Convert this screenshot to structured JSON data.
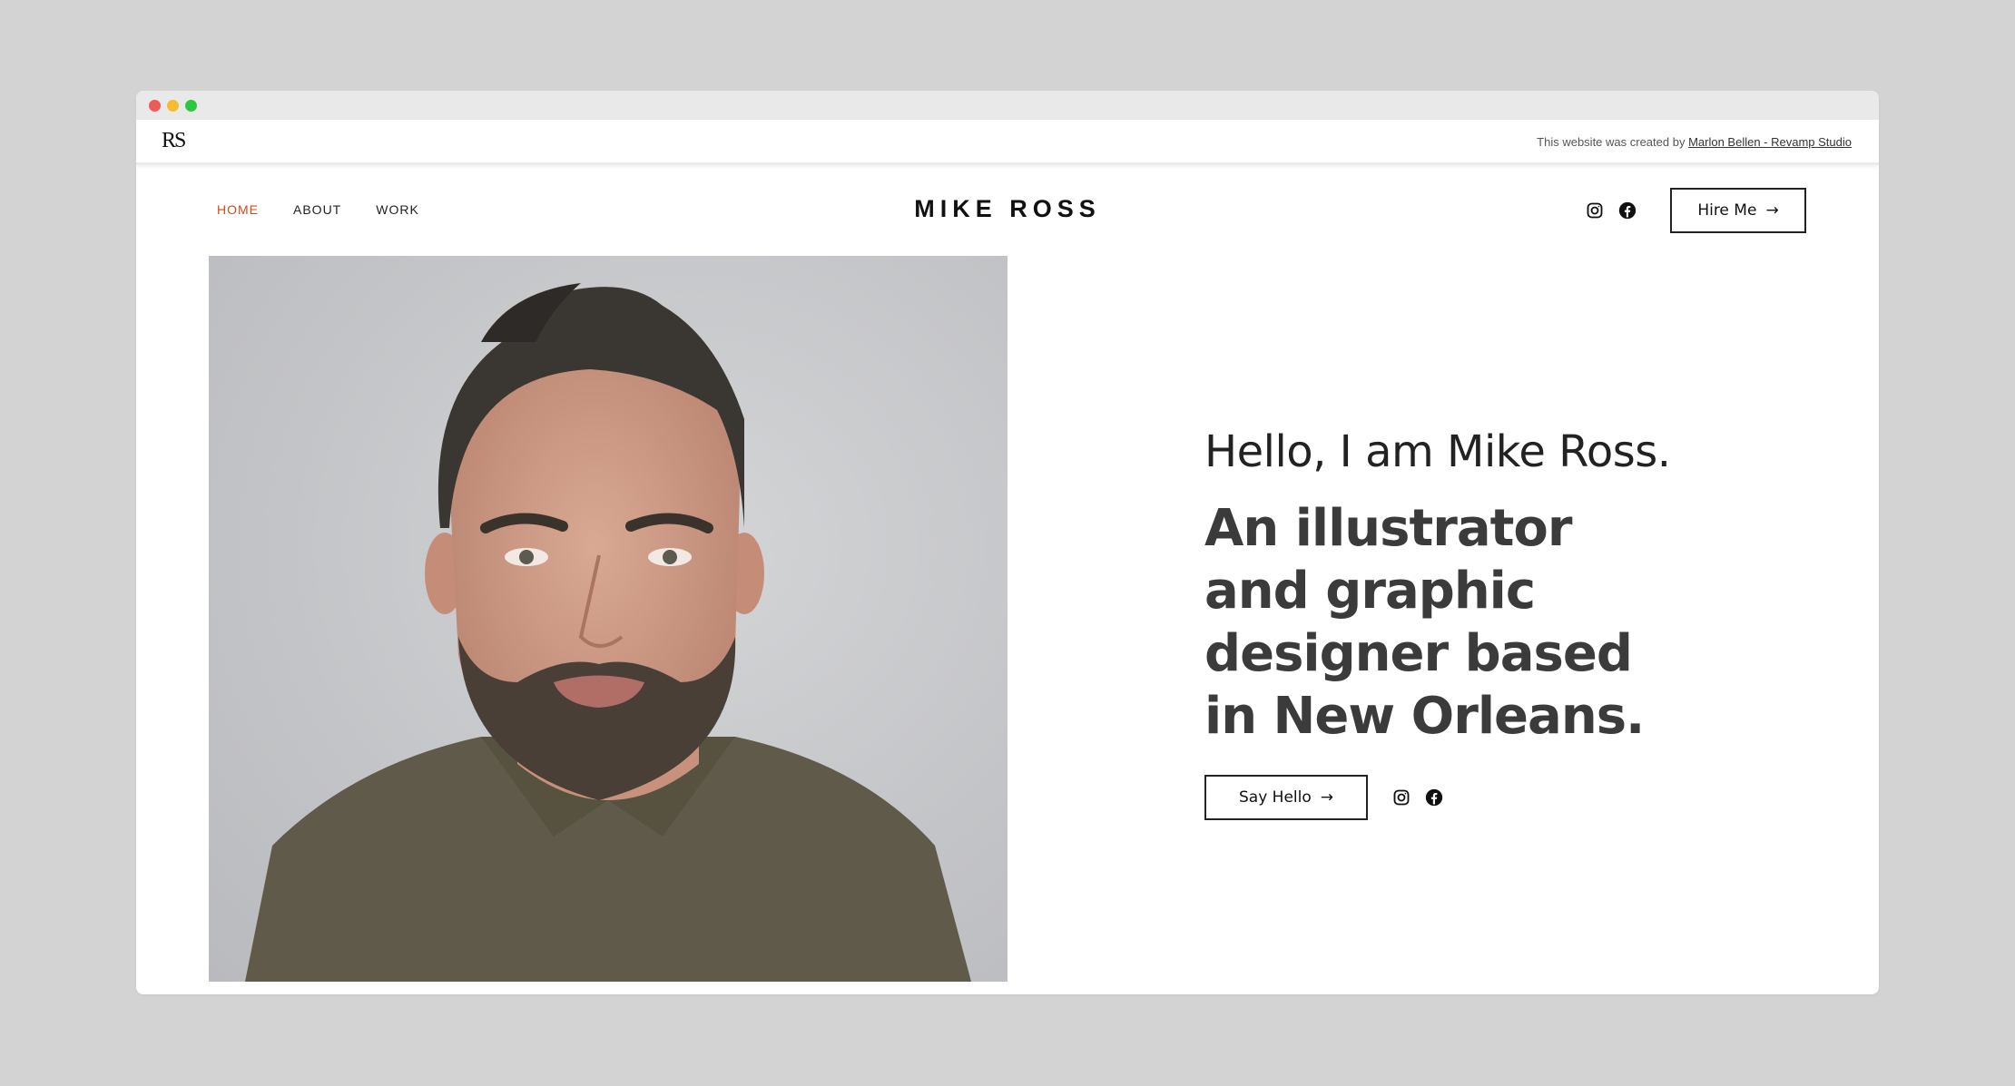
{
  "credit": {
    "prefix": "This website was created by",
    "link": "Marlon Bellen - Revamp Studio"
  },
  "logo": {
    "text": "RS"
  },
  "nav": {
    "items": [
      {
        "label": "HOME",
        "active": true
      },
      {
        "label": "ABOUT",
        "active": false
      },
      {
        "label": "WORK",
        "active": false
      }
    ],
    "brand": "MIKE ROSS",
    "hire_label": "Hire Me",
    "arrow": "→"
  },
  "hero": {
    "hello": "Hello, I am Mike Ross.",
    "tagline_lines": [
      "An illustrator",
      "and graphic",
      "designer based",
      "in New Orleans."
    ],
    "say_label": "Say Hello",
    "arrow": "→"
  },
  "icons": [
    "instagram-icon",
    "facebook-icon",
    "arrow-right-icon"
  ],
  "colors": {
    "accent": "#d2491b",
    "text_dark": "#3b3b3b",
    "page_bg": "#d3d3d3"
  }
}
